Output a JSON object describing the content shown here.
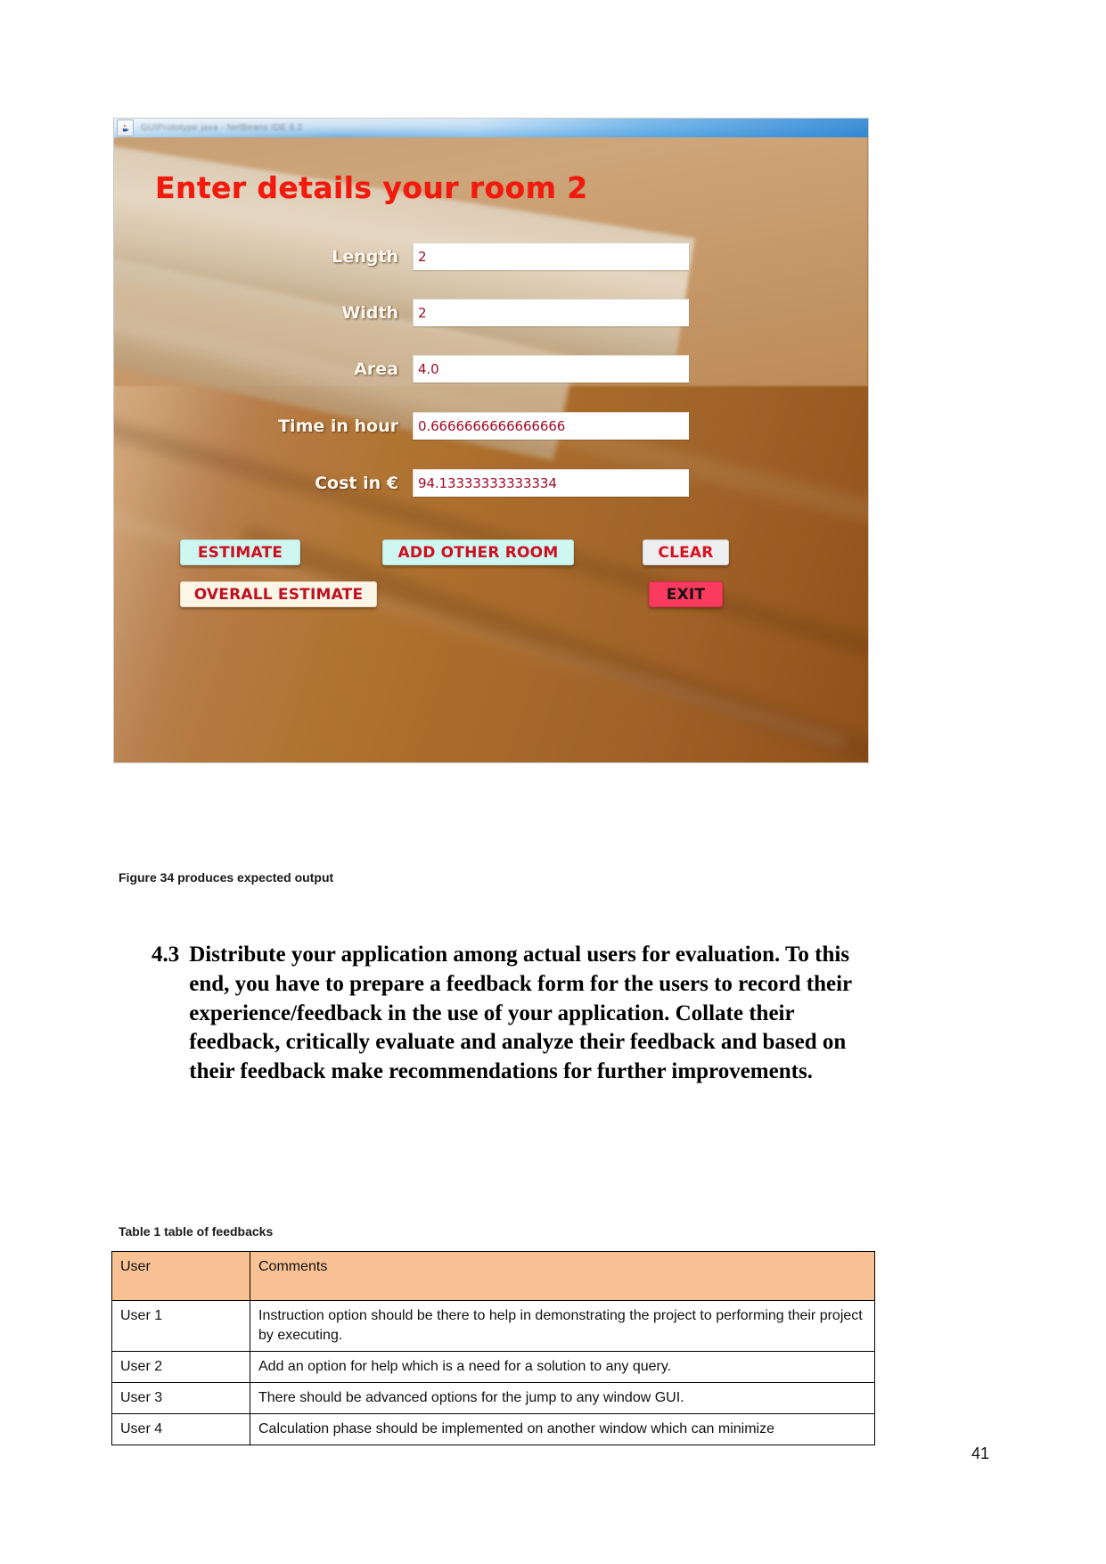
{
  "document": {
    "page_number": "41",
    "figure_caption": "Figure 34 produces expected output",
    "section": {
      "number": "4.3",
      "text": "Distribute your application among actual users for evaluation. To this end, you have to prepare a feedback form for the users to record their experience/feedback in the use of your application. Collate their feedback, critically evaluate and analyze their feedback and based on their feedback make recommendations for further improvements."
    },
    "table_caption": "Table 1 table of feedbacks",
    "table": {
      "headers": [
        "User",
        "Comments"
      ],
      "rows": [
        [
          "User 1",
          "Instruction option should be there to help in demonstrating the project to performing their project by executing."
        ],
        [
          "User 2",
          "Add an option for help which is a need for a solution to any query."
        ],
        [
          "User 3",
          "There should be advanced options for the jump to any window GUI."
        ],
        [
          "User 4",
          "Calculation phase should be implemented on another window which can minimize"
        ]
      ]
    }
  },
  "app": {
    "titlebar": {
      "title": "GUIPrototype java - NetBeans IDE 8.2",
      "icon": "java-cup-icon"
    },
    "heading": "Enter details your room 2",
    "fields": [
      {
        "label": "Length",
        "value": "2"
      },
      {
        "label": "Width",
        "value": "2"
      },
      {
        "label": "Area",
        "value": "4.0"
      },
      {
        "label": "Time in hour",
        "value": "0.6666666666666666"
      },
      {
        "label": "Cost in €",
        "value": "94.13333333333334"
      }
    ],
    "buttons": {
      "estimate": "ESTIMATE",
      "add_other_room": "ADD OTHER ROOM",
      "clear": "CLEAR",
      "overall_estimate": "OVERALL ESTIMATE",
      "exit": "EXIT"
    },
    "colors": {
      "heading": "#f31a0d",
      "field_value": "#9e0b26",
      "button_cyan_bg": "#cdf7f0",
      "button_gray_bg": "#eceef0",
      "button_cream_bg": "#fbf6e6",
      "button_exit_bg": "#fb3a60",
      "table_header_bg": "#f8c295"
    }
  }
}
